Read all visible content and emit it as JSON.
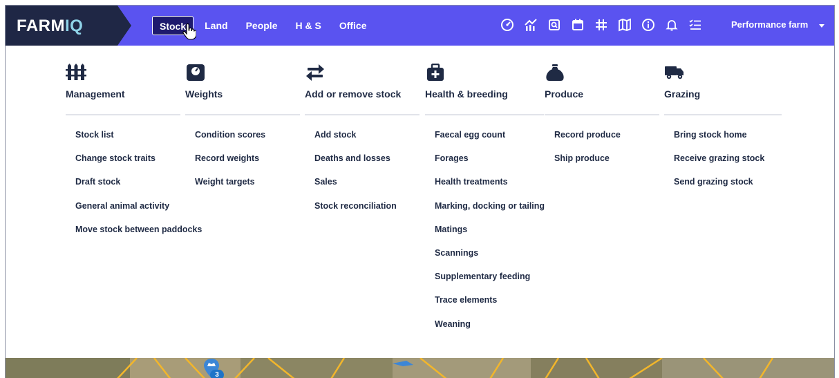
{
  "brand": {
    "logo_main": "FARM",
    "logo_accent": "IQ"
  },
  "nav": {
    "items": [
      {
        "label": "Stock",
        "active": true
      },
      {
        "label": "Land",
        "active": false
      },
      {
        "label": "People",
        "active": false
      },
      {
        "label": "H & S",
        "active": false
      },
      {
        "label": "Office",
        "active": false
      }
    ]
  },
  "toolbar_icons": [
    "gauge-icon",
    "analytics-icon",
    "documents-icon",
    "calendar-icon",
    "grid-icon",
    "map-icon",
    "info-icon",
    "bell-icon",
    "checklist-icon"
  ],
  "farm_selector": {
    "label": "Performance farm"
  },
  "menu": {
    "columns": [
      {
        "icon": "fence-icon",
        "title": "Management",
        "items": [
          "Stock list",
          "Change stock traits",
          "Draft stock",
          "General animal activity",
          "Move stock between paddocks"
        ]
      },
      {
        "icon": "scale-icon",
        "title": "Weights",
        "items": [
          "Condition scores",
          "Record weights",
          "Weight targets"
        ]
      },
      {
        "icon": "swap-icon",
        "title": "Add or remove stock",
        "items": [
          "Add stock",
          "Deaths and losses",
          "Sales",
          "Stock reconciliation"
        ]
      },
      {
        "icon": "medical-kit-icon",
        "title": "Health & breeding",
        "items": [
          "Faecal egg count",
          "Forages",
          "Health treatments",
          "Marking, docking or tailing",
          "Matings",
          "Scannings",
          "Supplementary feeding",
          "Trace elements",
          "Weaning"
        ]
      },
      {
        "icon": "sack-icon",
        "title": "Produce",
        "items": [
          "Record produce",
          "Ship produce"
        ]
      },
      {
        "icon": "truck-icon",
        "title": "Grazing",
        "items": [
          "Bring stock home",
          "Receive grazing stock",
          "Send grazing stock"
        ]
      }
    ]
  },
  "map": {
    "marker_count": "3"
  },
  "colors": {
    "nav_bg": "#5a53f0",
    "logo_bg": "#1f2745",
    "active_tab": "#1e1a6e",
    "text": "#1f2a44"
  }
}
